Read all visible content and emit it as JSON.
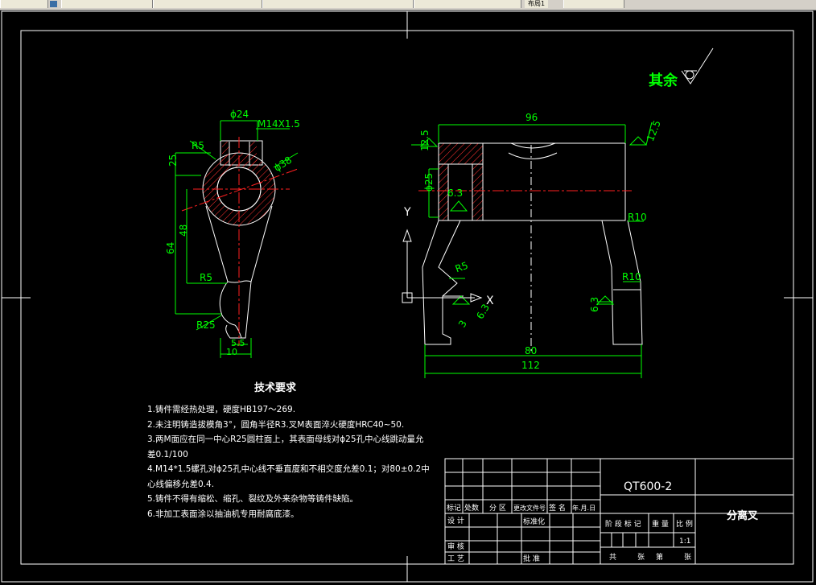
{
  "titlebar": {
    "tab_label": "布局1"
  },
  "surface_mark": {
    "label": "其余"
  },
  "left_view": {
    "dim_d24": "ϕ24",
    "dim_m14": "M14X1.5",
    "dim_r5_top": "R5",
    "dim_d38": "ϕ38",
    "dim_25": "25",
    "dim_48": "48",
    "dim_64": "64",
    "dim_r5_mid": "R5",
    "dim_r25": "R25",
    "dim_5_5": "5.5",
    "dim_10": "10"
  },
  "right_view": {
    "dim_96": "96",
    "rough_12_5_left": "12.5",
    "rough_12_5_right": "12.5",
    "dim_d25": "ϕ25",
    "rough_6_3_inner": "6.3",
    "dim_r10_top": "R10",
    "dim_r5": "R5",
    "dim_r10_right": "R10",
    "rough_6_3_bottom": "6.3",
    "rough_6_3_left": "6.3",
    "dim_3": "3",
    "dim_80": "80",
    "dim_112": "112",
    "axis_y": "Y",
    "axis_x": "X"
  },
  "tech_requirements": {
    "title": "技术要求",
    "items": [
      "1.铸件需经热处理，硬度HB197～269.",
      "2.未注明铸造拔模角3°，圆角半径R3.叉M表面淬火硬度HRC40~50.",
      "3.两M面应在同一中心R25圆柱面上，其表面母线对ϕ25孔中心线跳动量允",
      "差0.1/100",
      "4.M14*1.5螺孔对ϕ25孔中心线不垂直度和不相交度允差0.1；对80±0.2中",
      "心线偏移允差0.4.",
      "5.铸件不得有缩松、缩孔、裂纹及外来杂物等铸件缺陷。",
      "6.非加工表面涂以抽油机专用耐腐底漆。"
    ]
  },
  "title_block": {
    "material": "QT600-2",
    "part_name": "分离叉",
    "h_mark": "标记",
    "h_count": "处数",
    "h_zone": "分 区",
    "h_docno": "更改文件号",
    "h_sign": "签 名",
    "h_date": "年.月.日",
    "design": "设 计",
    "standardize": "标准化",
    "review": "审 核",
    "process": "工 艺",
    "approve": "批 准",
    "stage_mark": "阶 段 标 记",
    "weight": "重 量",
    "scale": "比 例",
    "scale_value": "1:1",
    "sheets_total": "共",
    "sheets_word": "张",
    "sheet_no": "第",
    "sheet_word": "张"
  },
  "colors": {
    "outline": "#ffffff",
    "dimension": "#00ff00",
    "center": "#ff0000",
    "hatch": "#ff0000"
  }
}
